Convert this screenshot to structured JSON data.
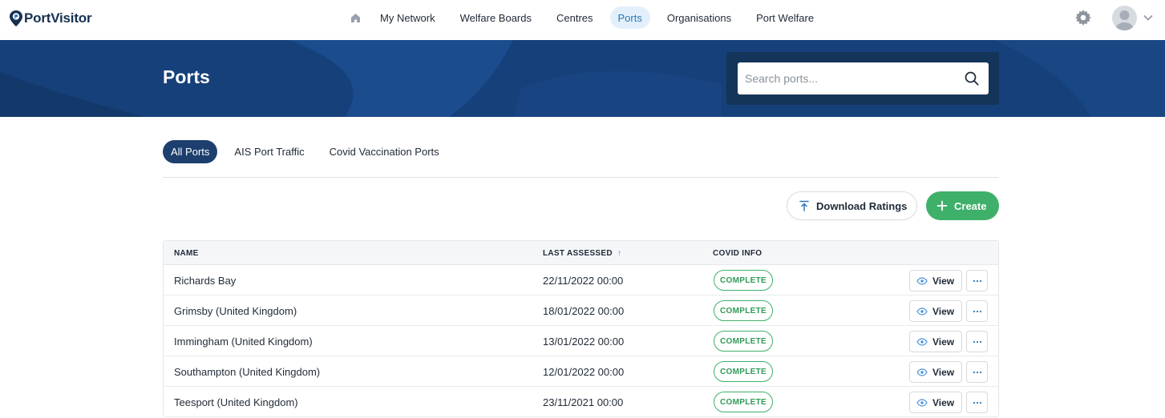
{
  "app": {
    "logo_text": "PortVisitor"
  },
  "nav": {
    "items": [
      {
        "label": "My Network"
      },
      {
        "label": "Welfare Boards"
      },
      {
        "label": "Centres"
      },
      {
        "label": "Ports",
        "active": true
      },
      {
        "label": "Organisations"
      },
      {
        "label": "Port Welfare"
      }
    ]
  },
  "header": {
    "title": "Ports"
  },
  "search": {
    "placeholder": "Search ports..."
  },
  "tabs": [
    {
      "label": "All Ports",
      "active": true
    },
    {
      "label": "AIS Port Traffic"
    },
    {
      "label": "Covid Vaccination Ports"
    }
  ],
  "actions": {
    "download_label": "Download Ratings",
    "create_label": "Create"
  },
  "table": {
    "columns": {
      "name": "NAME",
      "last_assessed": "LAST ASSESSED",
      "covid_info": "COVID INFO"
    },
    "view_label": "View",
    "rows": [
      {
        "name": "Richards Bay",
        "last_assessed": "22/11/2022 00:00",
        "covid_info": "COMPLETE"
      },
      {
        "name": "Grimsby (United Kingdom)",
        "last_assessed": "18/01/2022 00:00",
        "covid_info": "COMPLETE"
      },
      {
        "name": "Immingham (United Kingdom)",
        "last_assessed": "13/01/2022 00:00",
        "covid_info": "COMPLETE"
      },
      {
        "name": "Southampton (United Kingdom)",
        "last_assessed": "12/01/2022 00:00",
        "covid_info": "COMPLETE"
      },
      {
        "name": "Teesport (United Kingdom)",
        "last_assessed": "23/11/2021 00:00",
        "covid_info": "COMPLETE"
      }
    ]
  },
  "colors": {
    "brand": "#16304f",
    "banner": "#16407a",
    "accent": "#2a76b8",
    "success": "#3fb06a"
  }
}
